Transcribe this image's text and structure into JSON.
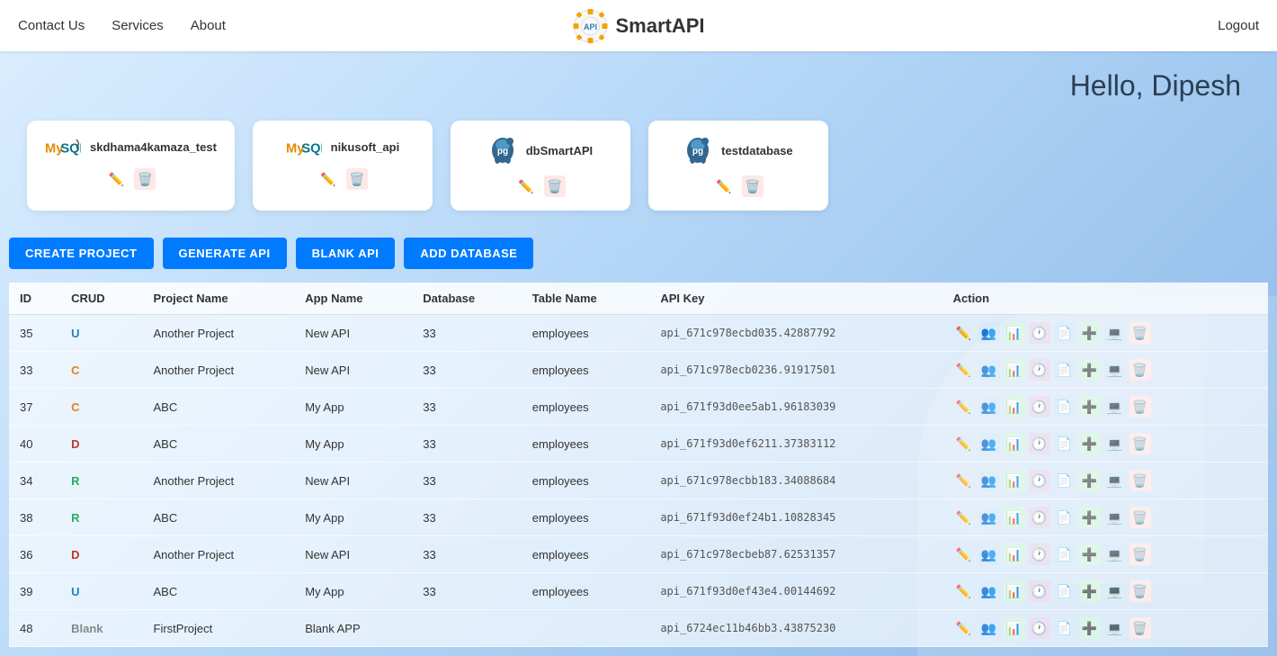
{
  "nav": {
    "links": [
      "Contact Us",
      "Services",
      "About"
    ],
    "brand": "SmartAPI",
    "logout": "Logout"
  },
  "greeting": "Hello, Dipesh",
  "databases": [
    {
      "name": "skdhama4kamaza_test",
      "type": "mysql"
    },
    {
      "name": "nikusoft_api",
      "type": "mysql"
    },
    {
      "name": "dbSmartAPI",
      "type": "postgres"
    },
    {
      "name": "testdatabase",
      "type": "postgres"
    }
  ],
  "buttons": [
    "CREATE PROJECT",
    "GENERATE API",
    "BLANK API",
    "ADD DATABASE"
  ],
  "table": {
    "headers": [
      "ID",
      "CRUD",
      "Project Name",
      "App Name",
      "Database",
      "Table Name",
      "API Key",
      "Action"
    ],
    "rows": [
      {
        "id": "35",
        "crud": "U",
        "project": "Another Project",
        "app": "New API",
        "db": "33",
        "table": "employees",
        "key": "api_671c978ecbd035.42887792"
      },
      {
        "id": "33",
        "crud": "C",
        "project": "Another Project",
        "app": "New API",
        "db": "33",
        "table": "employees",
        "key": "api_671c978ecb0236.91917501"
      },
      {
        "id": "37",
        "crud": "C",
        "project": "ABC",
        "app": "My App",
        "db": "33",
        "table": "employees",
        "key": "api_671f93d0ee5ab1.96183039"
      },
      {
        "id": "40",
        "crud": "D",
        "project": "ABC",
        "app": "My App",
        "db": "33",
        "table": "employees",
        "key": "api_671f93d0ef6211.37383112"
      },
      {
        "id": "34",
        "crud": "R",
        "project": "Another Project",
        "app": "New API",
        "db": "33",
        "table": "employees",
        "key": "api_671c978ecbb183.34088684"
      },
      {
        "id": "38",
        "crud": "R",
        "project": "ABC",
        "app": "My App",
        "db": "33",
        "table": "employees",
        "key": "api_671f93d0ef24b1.10828345"
      },
      {
        "id": "36",
        "crud": "D",
        "project": "Another Project",
        "app": "New API",
        "db": "33",
        "table": "employees",
        "key": "api_671c978ecbeb87.62531357"
      },
      {
        "id": "39",
        "crud": "U",
        "project": "ABC",
        "app": "My App",
        "db": "33",
        "table": "employees",
        "key": "api_671f93d0ef43e4.00144692"
      },
      {
        "id": "48",
        "crud": "Blank",
        "project": "FirstProject",
        "app": "Blank APP",
        "db": "",
        "table": "",
        "key": "api_6724ec11b46bb3.43875230"
      }
    ]
  }
}
